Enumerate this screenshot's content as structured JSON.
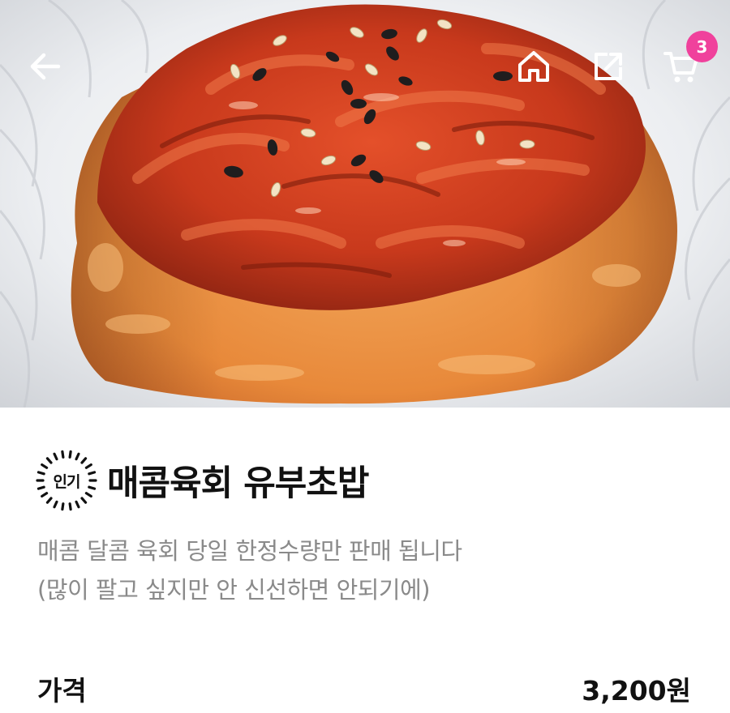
{
  "header": {
    "back_icon": "arrow-left-icon",
    "home_icon": "home-icon",
    "share_icon": "share-icon",
    "cart_icon": "cart-icon",
    "cart_count": "3",
    "icon_color": "#ffffff",
    "badge_color": "#f0419c"
  },
  "product": {
    "image_alt": "spicy yukhoe topped inari sushi photo",
    "badge_label": "인기",
    "title": "매콤육회 유부초밥",
    "description_lines": [
      "매콤 달콤 육회 당일 한정수량만 판매 됩니다",
      "(많이 팔고 싶지만 안 신선하면 안되기에)"
    ],
    "price_label": "가격",
    "price_value": "3,200원"
  }
}
